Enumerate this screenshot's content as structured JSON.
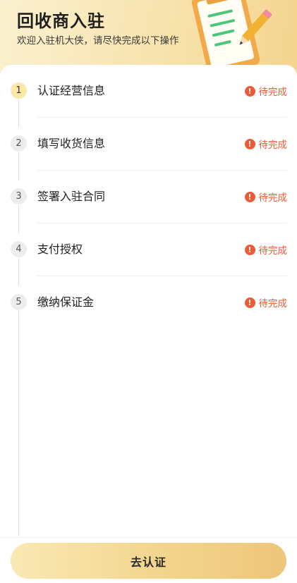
{
  "header": {
    "title": "回收商入驻",
    "subtitle": "欢迎入驻机大侠，请尽快完成以下操作",
    "illustration_icon": "clipboard-pencil-icon"
  },
  "steps": [
    {
      "number": "1",
      "label": "认证经营信息",
      "status": "待完成",
      "active": true
    },
    {
      "number": "2",
      "label": "填写收货信息",
      "status": "待完成",
      "active": false
    },
    {
      "number": "3",
      "label": "签署入驻合同",
      "status": "待完成",
      "active": false
    },
    {
      "number": "4",
      "label": "支付授权",
      "status": "待完成",
      "active": false
    },
    {
      "number": "5",
      "label": "缴纳保证金",
      "status": "待完成",
      "active": false
    }
  ],
  "status_icon_glyph": "!",
  "colors": {
    "accent": "#f2d58e",
    "status_pending": "#ec5a37"
  },
  "action": {
    "label": "去认证"
  }
}
